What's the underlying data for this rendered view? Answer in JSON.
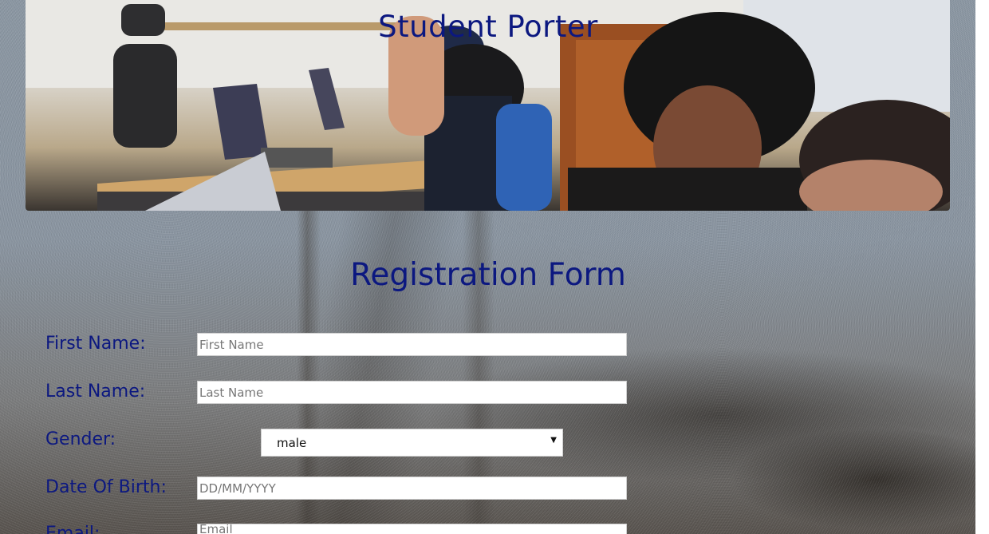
{
  "header": {
    "site_title": "Student Porter"
  },
  "form": {
    "title": "Registration Form",
    "fields": {
      "first_name": {
        "label": "First Name:",
        "placeholder": "First Name",
        "value": ""
      },
      "last_name": {
        "label": "Last Name:",
        "placeholder": "Last Name",
        "value": ""
      },
      "gender": {
        "label": "Gender:",
        "selected": "male"
      },
      "dob": {
        "label": "Date Of Birth:",
        "placeholder": "DD/MM/YYYY",
        "value": ""
      },
      "email": {
        "label": "Email:",
        "placeholder": "Email",
        "value": ""
      }
    }
  },
  "icons": {
    "select_arrow": "chevron-down-icon"
  },
  "colors": {
    "heading": "#0c1880",
    "input_bg": "#ffffff"
  }
}
